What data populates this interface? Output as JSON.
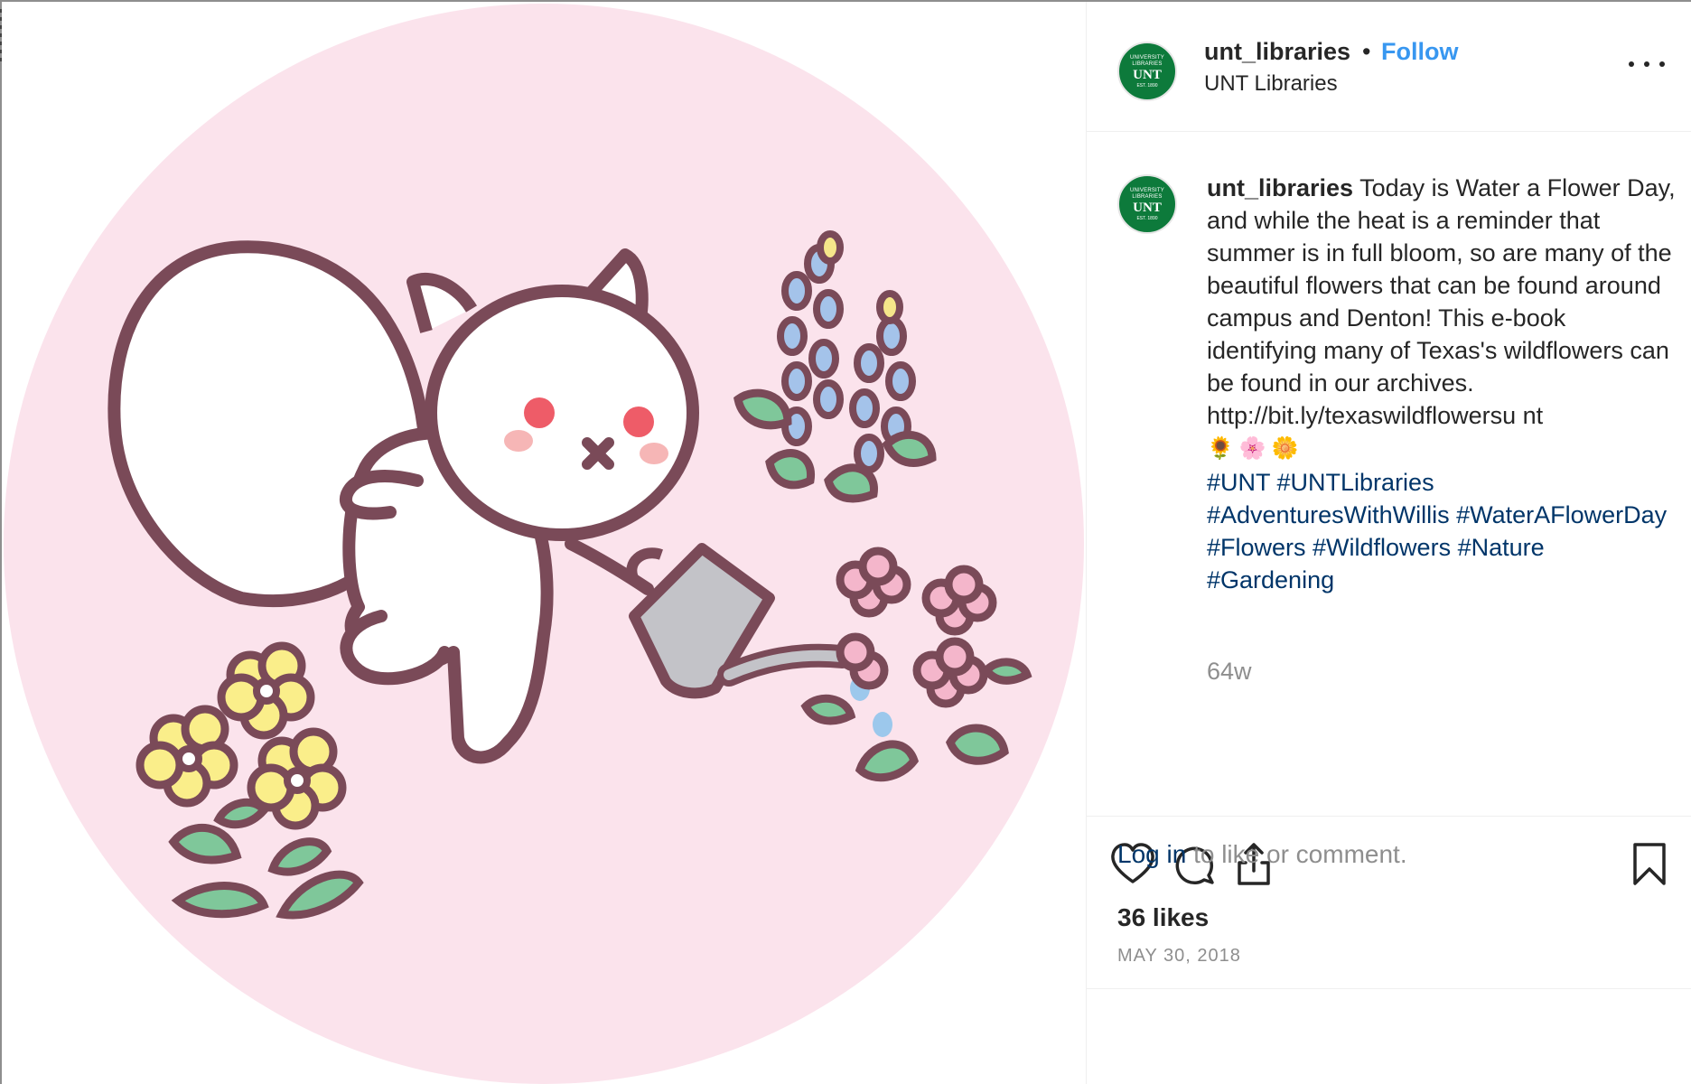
{
  "post": {
    "username": "unt_libraries",
    "separator": "•",
    "follow_label": "Follow",
    "display_name": "UNT Libraries",
    "avatar": {
      "line_top": "UNIVERSITY LIBRARIES",
      "line_mid": "UNT",
      "line_bottom": "EST. 1890"
    },
    "caption": {
      "username": "unt_libraries",
      "text": "Today is Water a Flower Day, and while the heat is a reminder that summer is in full bloom, so are many of the beautiful flowers that can be found around campus and Denton! This e-book identifying many of Texas's wildflowers can be found in our archives. http://bit.ly/texaswildflowersu nt",
      "emojis": "🌻🌸🌼",
      "hashtags": "#UNT #UNTLibraries #AdventuresWithWillis #WaterAFlowerDay #Flowers #Wildflowers #Nature #Gardening"
    },
    "time_ago": "64w",
    "likes": "36 likes",
    "date": "MAY 30, 2018",
    "login_link": "Log in",
    "login_rest": " to like or comment."
  },
  "icons": {
    "like": "heart-icon",
    "comment": "comment-icon",
    "share": "share-icon",
    "save": "bookmark-icon",
    "more": "more-options-icon"
  },
  "colors": {
    "follow": "#3897f0",
    "hashtag": "#003569",
    "muted": "#8e8e8e",
    "avatar_bg": "#0d7a3b",
    "illustration_bg": "#fbe3ec",
    "outline": "#7a4a58"
  }
}
